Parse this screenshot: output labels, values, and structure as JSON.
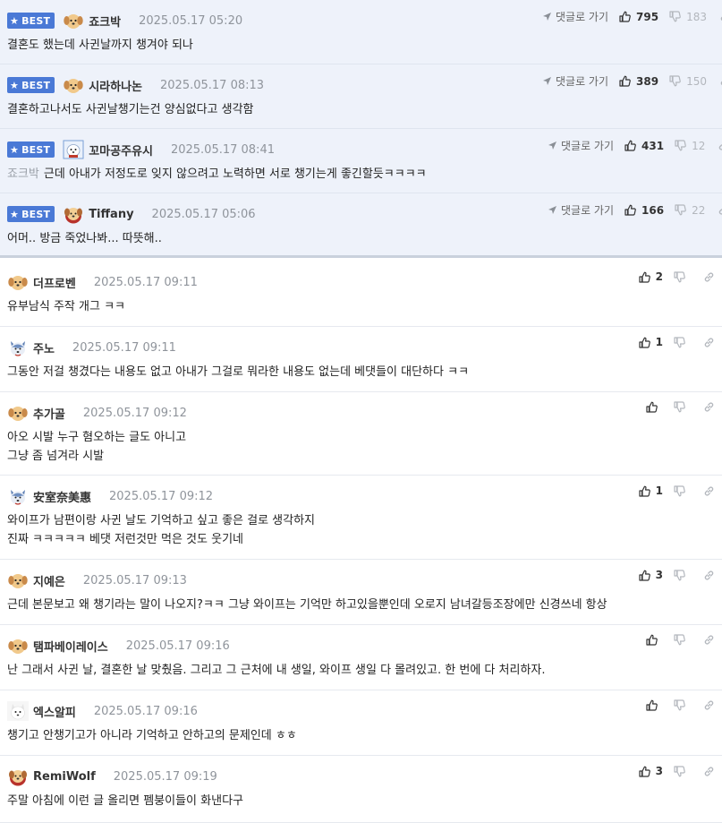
{
  "best_badge": "BEST",
  "reply_link_label": "댓글로 가기",
  "best_comments": [
    {
      "nick": "죠크박",
      "date": "2025.05.17 05:20",
      "text": "결혼도 했는데 사귄날까지 챙겨야 되나",
      "mention": "",
      "up": "795",
      "down": "183",
      "avatar": "puppy"
    },
    {
      "nick": "시라하나논",
      "date": "2025.05.17 08:13",
      "text": "결혼하고나서도 사귄날챙기는건 양심없다고 생각함",
      "mention": "",
      "up": "389",
      "down": "150",
      "avatar": "puppy"
    },
    {
      "nick": "꼬마공주유시",
      "date": "2025.05.17 08:41",
      "text": "근데 아내가 저정도로 잊지 않으려고 노력하면 서로 챙기는게 좋긴할듯ㅋㅋㅋㅋ",
      "mention": "죠크박",
      "up": "431",
      "down": "12",
      "avatar": "square-dog"
    },
    {
      "nick": "Tiffany",
      "date": "2025.05.17 05:06",
      "text": "어머.. 방금 죽었나봐... 따뜻해..",
      "mention": "",
      "up": "166",
      "down": "22",
      "avatar": "red-puppy"
    }
  ],
  "comments": [
    {
      "nick": "더프로벤",
      "date": "2025.05.17 09:11",
      "lines": [
        "유부남식 주작 개그 ㅋㅋ"
      ],
      "up": "2",
      "avatar": "puppy"
    },
    {
      "nick": "주노",
      "date": "2025.05.17 09:11",
      "lines": [
        "그동안 저걸 챙겼다는 내용도 없고 아내가 그걸로 뭐라한 내용도 없는데 베댓들이 대단하다 ㅋㅋ"
      ],
      "up": "1",
      "avatar": "husky"
    },
    {
      "nick": "추가골",
      "date": "2025.05.17 09:12",
      "lines": [
        "아오 시발 누구 혐오하는 글도 아니고",
        "그냥 좀 넘겨라 시발"
      ],
      "up": "",
      "avatar": "puppy"
    },
    {
      "nick": "安室奈美惠",
      "date": "2025.05.17 09:12",
      "lines": [
        "와이프가 남편이랑 사귄 날도 기억하고 싶고 좋은 걸로 생각하지",
        "진짜 ㅋㅋㅋㅋㅋ 베댓 저런것만 먹은 것도 웃기네"
      ],
      "up": "1",
      "avatar": "husky"
    },
    {
      "nick": "지예은",
      "date": "2025.05.17 09:13",
      "lines": [
        "근데 본문보고 왜 챙기라는 말이 나오지?ㅋㅋ 그냥 와이프는 기억만 하고있을뿐인데 오로지 남녀갈등조장에만 신경쓰네 항상"
      ],
      "up": "3",
      "avatar": "puppy"
    },
    {
      "nick": "탬파베이레이스",
      "date": "2025.05.17 09:16",
      "lines": [
        "난 그래서 사귄 날, 결혼한 날 맞췄음. 그리고 그 근처에 내 생일, 와이프 생일 다 몰려있고. 한 번에 다 처리하자."
      ],
      "up": "",
      "avatar": "puppy"
    },
    {
      "nick": "엑스알피",
      "date": "2025.05.17 09:16",
      "lines": [
        "챙기고 안챙기고가 아니라 기억하고 안하고의 문제인데 ㅎㅎ"
      ],
      "up": "",
      "avatar": "white-dog"
    },
    {
      "nick": "RemiWolf",
      "date": "2025.05.17 09:19",
      "lines": [
        "주말 아침에 이런 글 올리면 펨붕이들이 화낸다구"
      ],
      "up": "3",
      "avatar": "red-puppy"
    }
  ],
  "colors": {
    "best_bg": "#eef2fa",
    "badge": "#4a79d6",
    "date": "#8f949b",
    "mention": "#9aa0a8"
  }
}
